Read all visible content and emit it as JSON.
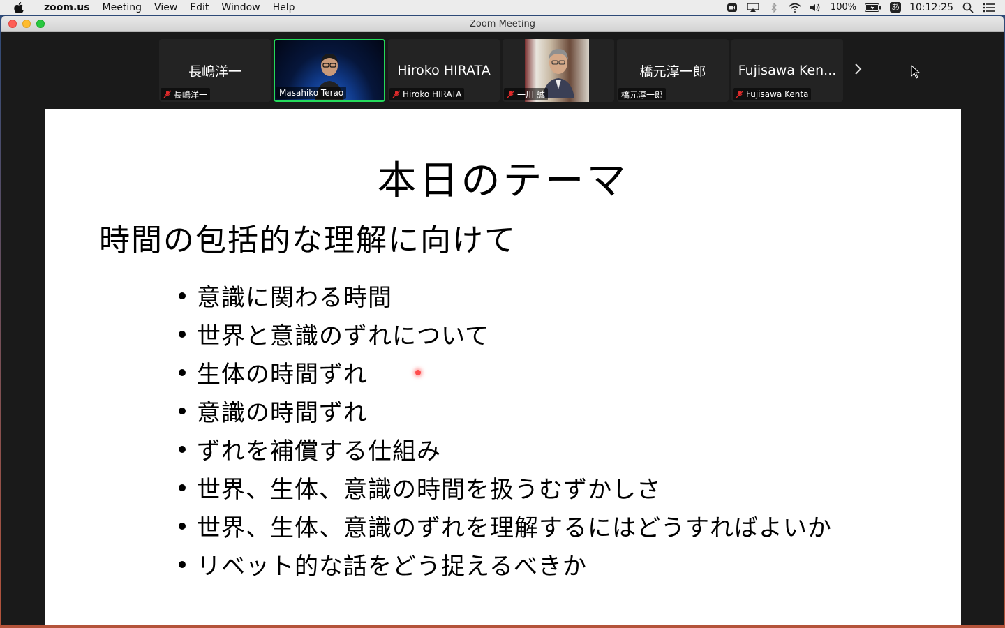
{
  "menubar": {
    "app": "zoom.us",
    "items": [
      "Meeting",
      "View",
      "Edit",
      "Window",
      "Help"
    ],
    "battery": "100%",
    "ime": "あ",
    "clock": "10:12:25",
    "icons": [
      "zoom-icon",
      "airplay-icon",
      "bluetooth-icon",
      "wifi-icon",
      "volume-icon",
      "battery-icon",
      "input-source-icon",
      "spotlight-icon",
      "control-center-icon"
    ]
  },
  "window": {
    "title": "Zoom Meeting"
  },
  "participants": [
    {
      "display": "長嶋洋一",
      "label": "長嶋洋一",
      "muted": true,
      "video": false
    },
    {
      "display": "",
      "label": "Masahiko Terao",
      "muted": false,
      "video": true,
      "active": true
    },
    {
      "display": "Hiroko HIRATA",
      "label": "Hiroko HIRATA",
      "muted": true,
      "video": false
    },
    {
      "display": "",
      "label": "一川 誠",
      "muted": true,
      "video": true
    },
    {
      "display": "橋元淳一郎",
      "label": "橋元淳一郎",
      "muted": false,
      "video": false
    },
    {
      "display": "Fujisawa Ken...",
      "label": "Fujisawa Kenta",
      "muted": true,
      "video": false
    }
  ],
  "slide": {
    "title": "本日のテーマ",
    "subtitle": "時間の包括的な理解に向けて",
    "bullets": [
      "意識に関わる時間",
      "世界と意識のずれについて",
      "生体の時間ずれ",
      "意識の時間ずれ",
      "ずれを補償する仕組み",
      "世界、生体、意識の時間を扱うむずかしさ",
      "世界、生体、意識のずれを理解するにはどうすればよいか",
      "リベット的な話をどう捉えるべきか"
    ]
  },
  "colors": {
    "active_speaker": "#23d959",
    "muted_mic": "#e02a2a",
    "laser": "#ff4d4d"
  }
}
